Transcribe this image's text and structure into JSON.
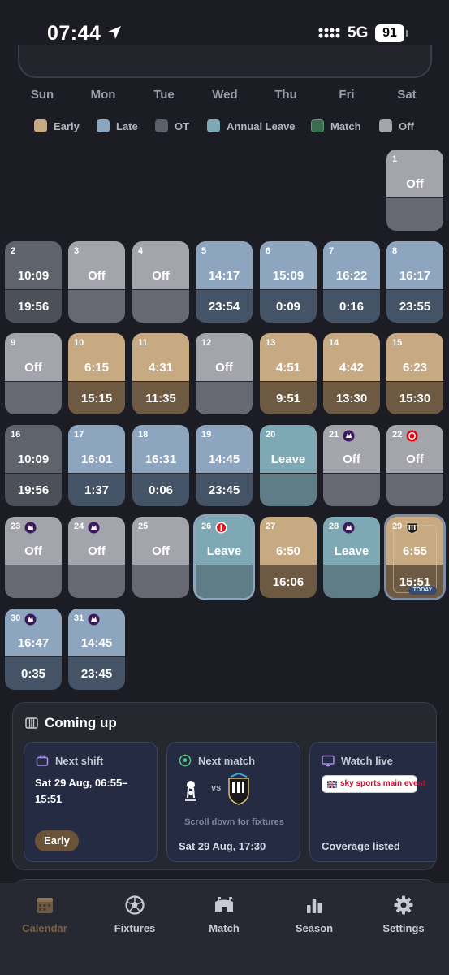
{
  "status_bar": {
    "time": "07:44",
    "network": "5G",
    "battery": "91"
  },
  "weekdays": [
    "Sun",
    "Mon",
    "Tue",
    "Wed",
    "Thu",
    "Fri",
    "Sat"
  ],
  "legend": [
    {
      "label": "Early",
      "color": "#c8aa82"
    },
    {
      "label": "Late",
      "color": "#8ea5bf"
    },
    {
      "label": "OT",
      "color": "#5b6069"
    },
    {
      "label": "Annual Leave",
      "color": "#7fa8b5"
    },
    {
      "label": "Match",
      "color": "#3d6b52"
    },
    {
      "label": "Off",
      "color": "#a4a4ad"
    }
  ],
  "colors": {
    "early_top": "#c8aa82",
    "early_bottom": "#6e5a43",
    "late_top": "#8ea5bf",
    "late_bottom": "#455366",
    "ot_top": "#5e636c",
    "ot_bottom": "#4b5059",
    "leave_top": "#7fa8b5",
    "leave_bottom": "#5e7d87",
    "off_top": "#a4a4ad",
    "off_bottom": "#686872",
    "active_nav": "#7a6146"
  },
  "calendar": {
    "days": [
      {
        "day": "1",
        "type": "off",
        "start": "Off",
        "end": "",
        "badge": ""
      },
      {
        "day": "2",
        "type": "ot",
        "start": "10:09",
        "end": "19:56",
        "badge": ""
      },
      {
        "day": "3",
        "type": "off",
        "start": "Off",
        "end": "",
        "badge": ""
      },
      {
        "day": "4",
        "type": "off",
        "start": "Off",
        "end": "",
        "badge": ""
      },
      {
        "day": "5",
        "type": "late",
        "start": "14:17",
        "end": "23:54",
        "badge": ""
      },
      {
        "day": "6",
        "type": "late",
        "start": "15:09",
        "end": "0:09",
        "badge": ""
      },
      {
        "day": "7",
        "type": "late",
        "start": "16:22",
        "end": "0:16",
        "badge": ""
      },
      {
        "day": "8",
        "type": "late",
        "start": "16:17",
        "end": "23:55",
        "badge": ""
      },
      {
        "day": "9",
        "type": "off",
        "start": "Off",
        "end": "",
        "badge": ""
      },
      {
        "day": "10",
        "type": "early",
        "start": "6:15",
        "end": "15:15",
        "badge": ""
      },
      {
        "day": "11",
        "type": "early",
        "start": "4:31",
        "end": "11:35",
        "badge": ""
      },
      {
        "day": "12",
        "type": "off",
        "start": "Off",
        "end": "",
        "badge": ""
      },
      {
        "day": "13",
        "type": "early",
        "start": "4:51",
        "end": "9:51",
        "badge": ""
      },
      {
        "day": "14",
        "type": "early",
        "start": "4:42",
        "end": "13:30",
        "badge": ""
      },
      {
        "day": "15",
        "type": "early",
        "start": "6:23",
        "end": "15:30",
        "badge": ""
      },
      {
        "day": "16",
        "type": "ot",
        "start": "10:09",
        "end": "19:56",
        "badge": ""
      },
      {
        "day": "17",
        "type": "late",
        "start": "16:01",
        "end": "1:37",
        "badge": ""
      },
      {
        "day": "18",
        "type": "late",
        "start": "16:31",
        "end": "0:06",
        "badge": ""
      },
      {
        "day": "19",
        "type": "late",
        "start": "14:45",
        "end": "23:45",
        "badge": ""
      },
      {
        "day": "20",
        "type": "leave",
        "start": "Leave",
        "end": "",
        "badge": ""
      },
      {
        "day": "21",
        "type": "off",
        "start": "Off",
        "end": "",
        "badge": "premier-league-icon"
      },
      {
        "day": "22",
        "type": "off",
        "start": "Off",
        "end": "",
        "badge": "brentford-crest-icon"
      },
      {
        "day": "23",
        "type": "off",
        "start": "Off",
        "end": "",
        "badge": "premier-league-icon"
      },
      {
        "day": "24",
        "type": "off",
        "start": "Off",
        "end": "",
        "badge": "premier-league-icon"
      },
      {
        "day": "25",
        "type": "off",
        "start": "Off",
        "end": "",
        "badge": ""
      },
      {
        "day": "26",
        "type": "leave",
        "start": "Leave",
        "end": "",
        "badge": "southampton-crest-icon"
      },
      {
        "day": "27",
        "type": "early",
        "start": "6:50",
        "end": "16:06",
        "badge": ""
      },
      {
        "day": "28",
        "type": "leave",
        "start": "Leave",
        "end": "",
        "badge": "premier-league-icon"
      },
      {
        "day": "29",
        "type": "early",
        "start": "6:55",
        "end": "15:51",
        "badge": "newcastle-crest-icon",
        "today": "TODAY"
      },
      {
        "day": "30",
        "type": "late",
        "start": "16:47",
        "end": "0:35",
        "badge": "premier-league-icon"
      },
      {
        "day": "31",
        "type": "late",
        "start": "14:45",
        "end": "23:45",
        "badge": "premier-league-icon"
      }
    ]
  },
  "coming_up": {
    "title": "Coming up",
    "next_shift": {
      "title": "Next shift",
      "text": "Sat 29 Aug, 06:55–15:51",
      "tag": "Early"
    },
    "next_match": {
      "title": "Next match",
      "home_icon": "tottenham-crest-icon",
      "vs": "vs",
      "away_icon": "newcastle-crest-icon",
      "hint": "Scroll down for fixtures",
      "date": "Sat 29 Aug, 17:30"
    },
    "watch_live": {
      "title": "Watch live",
      "broadcaster": "sky sports main event",
      "coverage": "Coverage listed"
    }
  },
  "bottom_nav": [
    {
      "label": "Calendar",
      "icon": "calendar-icon",
      "active": true
    },
    {
      "label": "Fixtures",
      "icon": "football-icon",
      "active": false
    },
    {
      "label": "Match",
      "icon": "stadium-icon",
      "active": false
    },
    {
      "label": "Season",
      "icon": "bar-chart-icon",
      "active": false
    },
    {
      "label": "Settings",
      "icon": "gear-icon",
      "active": false
    }
  ]
}
